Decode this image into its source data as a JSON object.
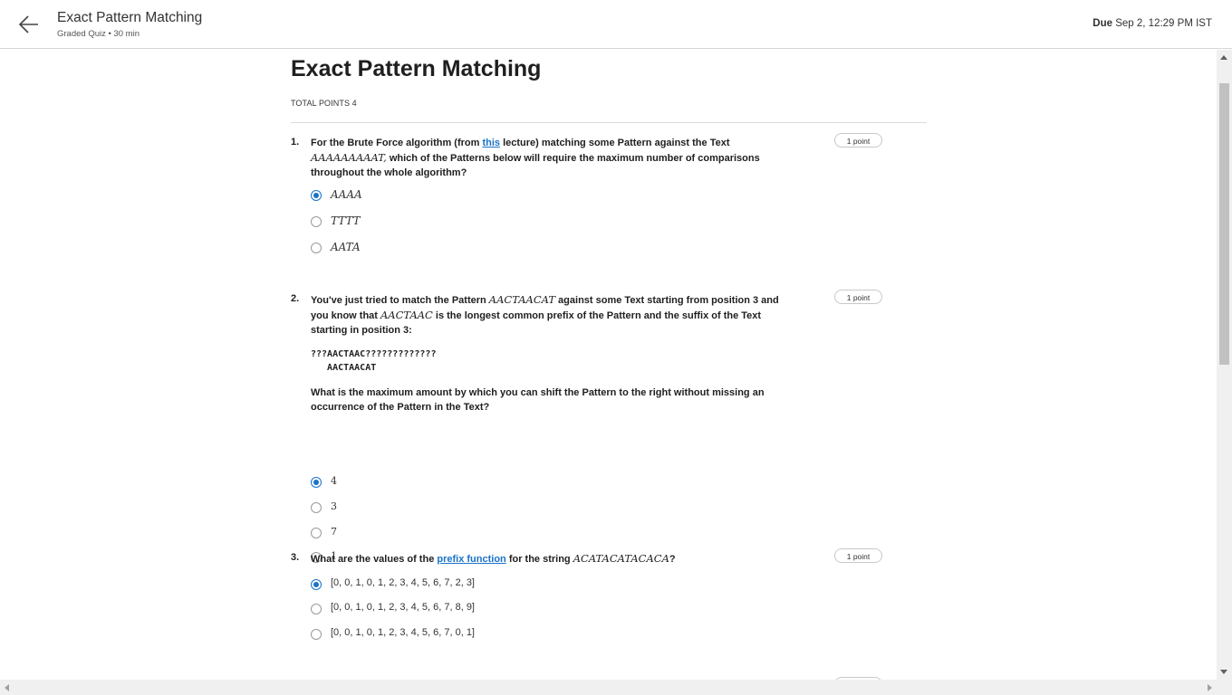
{
  "header": {
    "title": "Exact Pattern Matching",
    "subtitle": "Graded Quiz • 30 min",
    "due_label": "Due",
    "due_value": "Sep 2, 12:29 PM IST"
  },
  "quiz": {
    "title": "Exact Pattern Matching",
    "total_points": "TOTAL POINTS 4",
    "questions": [
      {
        "number": "1.",
        "points": "1 point",
        "text_a": "For the Brute Force algorithm (from ",
        "link": "this",
        "text_b": " lecture) matching some Pattern against the Text ",
        "math": "AAAAAAAAAT,",
        "text_c": " which of the Patterns below will require the maximum number of comparisons throughout the whole algorithm?",
        "options": [
          {
            "label": "AAAA",
            "selected": true
          },
          {
            "label": "TTTT",
            "selected": false
          },
          {
            "label": "AATA",
            "selected": false
          }
        ]
      },
      {
        "number": "2.",
        "points": "1 point",
        "text_a": "You've just tried to match the Pattern ",
        "math_a": "AACTAACAT",
        "text_b": " against some Text starting from position 3 and you know that ",
        "math_b": "AACTAAC",
        "text_c": " is the longest common prefix of the Pattern and the suffix of the Text starting in position 3:",
        "code_line1": "???AACTAAC?????????????",
        "code_line2": "   AACTAACAT",
        "followup": "What is the maximum amount by which you can shift the Pattern to the right without missing an occurrence of the Pattern in the Text?",
        "options": [
          {
            "label": "4",
            "selected": true
          },
          {
            "label": "3",
            "selected": false
          },
          {
            "label": "7",
            "selected": false
          },
          {
            "label": "1",
            "selected": false
          }
        ]
      },
      {
        "number": "3.",
        "points": "1 point",
        "text_a": "What are the values of the ",
        "link": "prefix function",
        "text_b": " for the string ",
        "math": "ACATACATACACA",
        "text_c": "?",
        "options": [
          {
            "label": "[0, 0, 1, 0, 1, 2, 3, 4, 5, 6, 7, 2, 3]",
            "selected": true
          },
          {
            "label": "[0, 0, 1, 0, 1, 2, 3, 4, 5, 6, 7, 8, 9]",
            "selected": false
          },
          {
            "label": "[0, 0, 1, 0, 1, 2, 3, 4, 5, 6, 7, 0, 1]",
            "selected": false
          }
        ]
      }
    ]
  },
  "colors": {
    "accent": "#1a73c8",
    "text": "#1f1f1f",
    "divider": "#dcdcdc"
  }
}
